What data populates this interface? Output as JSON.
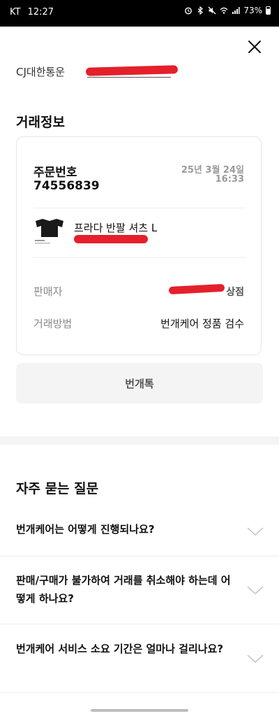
{
  "status_bar": {
    "carrier": "KT",
    "time": "12:27",
    "battery": "73%",
    "icons": [
      "alarm-icon",
      "bluetooth-icon",
      "mute-icon",
      "wifi-icon",
      "signal-icon",
      "battery-icon"
    ]
  },
  "courier": {
    "label": "CJ대한통운"
  },
  "transaction": {
    "section_title": "거래정보",
    "order_label": "주문번호",
    "order_number": "74556839",
    "order_date": "25년 3월 24일",
    "order_time": "16:33",
    "product_name": "프라다 반팔 셔츠 L",
    "seller_label": "판매자",
    "seller_suffix": "상점",
    "method_label": "거래방법",
    "method_value": "번개케어 정품 검수"
  },
  "chat_button": {
    "label": "번개톡"
  },
  "faq": {
    "title": "자주 묻는 질문",
    "items": [
      {
        "question": "번개케어는 어떻게 진행되나요?"
      },
      {
        "question": "판매/구매가 불가하여 거래를 취소해야 하는데 어떻게 하나요?"
      },
      {
        "question": "번개케어 서비스 소요 기간은 얼마나 걸리나요?"
      }
    ]
  },
  "colors": {
    "redaction": "#e4202b",
    "muted_text": "#8a8a8a",
    "button_bg": "#f4f4f4"
  }
}
